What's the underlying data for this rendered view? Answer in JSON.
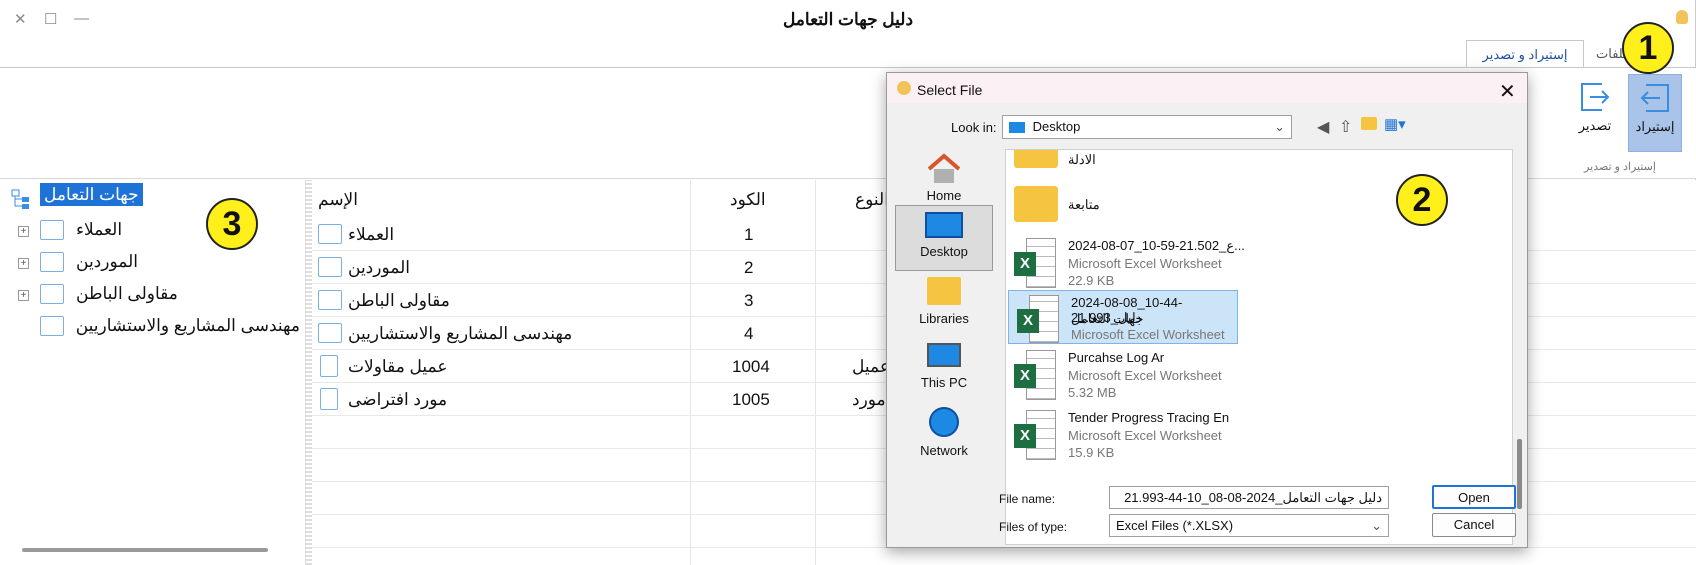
{
  "window": {
    "title": "دليل جهات التعامل",
    "close_glyph": "✕",
    "maximize_glyph": "☐",
    "minimize_glyph": "—"
  },
  "ribbon": {
    "tabs": [
      {
        "label": "إستيراد و تصدير"
      },
      {
        "label": "ملفات"
      }
    ],
    "import_label": "إستيراد",
    "export_label": "تصدير",
    "group_label": "إستيراد و تصدير"
  },
  "tree": {
    "root": "جهات التعامل",
    "items": [
      {
        "label": "العملاء",
        "expander": "+"
      },
      {
        "label": "الموردين",
        "expander": "+"
      },
      {
        "label": "مقاولى الباطن",
        "expander": "+"
      },
      {
        "label": "مهندسى المشاريع والاستشاريين",
        "expander": ""
      }
    ]
  },
  "grid": {
    "headers": {
      "name": "الإسم",
      "code": "الكود",
      "type": "النوع"
    },
    "rows": [
      {
        "name": "العملاء",
        "code": "1",
        "type": "",
        "icon": "folder-icon"
      },
      {
        "name": "الموردين",
        "code": "2",
        "type": "",
        "icon": "folder-icon"
      },
      {
        "name": "مقاولى الباطن",
        "code": "3",
        "type": "",
        "icon": "folder-icon"
      },
      {
        "name": "مهندسى المشاريع والاستشاريين",
        "code": "4",
        "type": "",
        "icon": "folder-icon"
      },
      {
        "name": "عميل مقاولات",
        "code": "1004",
        "type": "عميل",
        "icon": "document-icon"
      },
      {
        "name": "مورد افتراضى",
        "code": "1005",
        "type": "مورد",
        "icon": "document-icon"
      }
    ]
  },
  "dialog": {
    "title": "Select File",
    "look_in_label": "Look in:",
    "look_in_value": "Desktop",
    "places": [
      "Home",
      "Desktop",
      "Libraries",
      "This PC",
      "Network"
    ],
    "files": [
      {
        "name": "الادلة",
        "type": "",
        "size": "",
        "kind": "folder"
      },
      {
        "name": "متابعة",
        "type": "",
        "size": "",
        "kind": "folder"
      },
      {
        "name": "2024-08-07_10-59-21.502_ع...",
        "type": "Microsoft Excel Worksheet",
        "size": "22.9 KB",
        "kind": "excel"
      },
      {
        "name": "2024-08-08_10-44-21.993_دليل",
        "name2": "جهات التعامل",
        "type": "Microsoft Excel Worksheet",
        "size": "",
        "kind": "excel",
        "selected": true
      },
      {
        "name": "Purcahse Log Ar",
        "type": "Microsoft Excel Worksheet",
        "size": "5.32 MB",
        "kind": "excel"
      },
      {
        "name": "Tender Progress Tracing En",
        "type": "Microsoft Excel Worksheet",
        "size": "15.9 KB",
        "kind": "excel"
      }
    ],
    "file_name_label": "File name:",
    "file_name_value": "دليل جهات التعامل_2024-08-08_10-44-21.993",
    "file_type_label": "Files of type:",
    "file_type_value": "Excel Files (*.XLSX)",
    "open_label": "Open",
    "cancel_label": "Cancel"
  },
  "annotations": [
    "1",
    "2",
    "3"
  ],
  "colors": {
    "accent": "#1f73d6",
    "badge": "#ffef1a",
    "excel": "#1d6f42",
    "folder": "#f5c542"
  }
}
